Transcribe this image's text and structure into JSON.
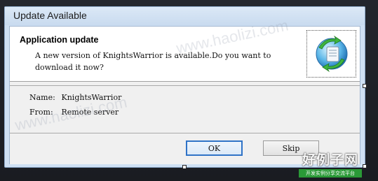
{
  "window": {
    "title": "Update Available"
  },
  "header": {
    "title": "Application update",
    "message": "A new version of KnightsWarrior is available.Do you want to download it now?",
    "icon": "update-globe-icon"
  },
  "details": {
    "name_label": "Name:",
    "name_value": "KnightsWarrior",
    "from_label": "From:",
    "from_value": "Remote server"
  },
  "buttons": {
    "ok": "OK",
    "skip": "Skip"
  },
  "watermark": {
    "text": "www.haolizi.com",
    "logo_main": "好例子网",
    "logo_sub": "开发实例分享交流平台"
  },
  "colors": {
    "accent": "#2f73c7",
    "titlebar": "#cfe0f3"
  }
}
